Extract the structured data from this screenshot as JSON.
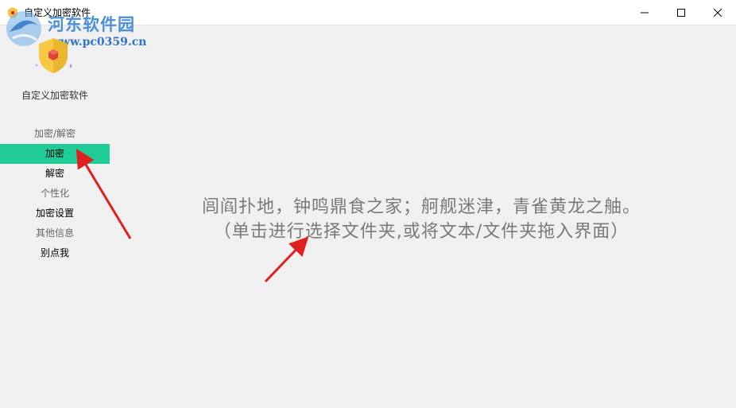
{
  "window": {
    "title": "自定义加密软件",
    "minimize_icon": "minimize-icon",
    "maximize_icon": "maximize-icon",
    "close_icon": "close-icon"
  },
  "watermark": {
    "title": "河东软件园",
    "url": "www.pc0359.cn"
  },
  "sidebar": {
    "app_name": "自定义加密软件",
    "items": [
      {
        "label": "加密/解密",
        "kind": "group"
      },
      {
        "label": "加密",
        "kind": "link",
        "active": true
      },
      {
        "label": "解密",
        "kind": "link"
      },
      {
        "label": "个性化",
        "kind": "group"
      },
      {
        "label": "加密设置",
        "kind": "link"
      },
      {
        "label": "其他信息",
        "kind": "group"
      },
      {
        "label": "别点我",
        "kind": "link"
      }
    ],
    "active_color": "#1fcc98"
  },
  "main": {
    "quote": "闾阎扑地，钟鸣鼎食之家；舸舰迷津，青雀黄龙之舳。",
    "hint": "（单击进行选择文件夹,或将文本/文件夹拖入界面）"
  },
  "annotation_color": "#e02020"
}
